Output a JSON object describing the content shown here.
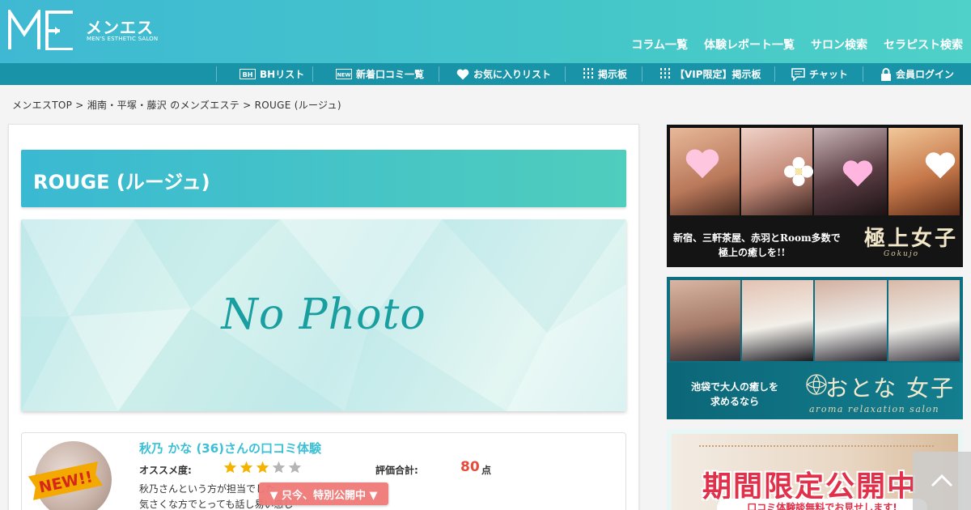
{
  "header": {
    "logo_kana": "メンエス",
    "logo_sub": "MEN'S ESTHETIC SALON",
    "nav": [
      "コラム一覧",
      "体験レポート一覧",
      "サロン検索",
      "セラピスト検索"
    ]
  },
  "subnav": [
    {
      "label": "BHリスト",
      "icon": "bh-icon"
    },
    {
      "label": "新着口コミ一覧",
      "icon": "new-icon"
    },
    {
      "label": "お気に入りリスト",
      "icon": "heart-icon"
    },
    {
      "label": "掲示板",
      "icon": "board-icon"
    },
    {
      "label": "【VIP限定】掲示板",
      "icon": "vip-board-icon"
    },
    {
      "label": "チャット",
      "icon": "chat-icon"
    },
    {
      "label": "会員ログイン",
      "icon": "lock-icon"
    }
  ],
  "breadcrumb": "メンエスTOP > 湘南・平塚・藤沢 のメンズエステ > ROUGE (ルージュ)",
  "salon": {
    "title": "ROUGE (ルージュ)",
    "no_photo": "No Photo"
  },
  "review": {
    "badge": "NEW!!",
    "title": "秋乃 かな (36)さんの口コミ体験",
    "recommend_label": "オススメ度:",
    "stars_filled": 3,
    "stars_total": 5,
    "total_label": "評価合計:",
    "score": "80",
    "score_unit": "点",
    "text_line1": "秋乃さんという方が担当でした",
    "text_line2": "気さくな方でとっても話し易い感じ",
    "special_button": "▼ 只今、特別公開中 ▼"
  },
  "banners": {
    "b1_copy_line1": "新宿、三軒茶屋、赤羽とRoom多数で",
    "b1_copy_line2": "極上の癒しを!!",
    "b1_brand": "極上女子",
    "b1_brand_sub": "Gokujo",
    "b2_copy_line1": "池袋で大人の癒しを",
    "b2_copy_line2": "求めるなら",
    "b2_brand": "おとな 女子",
    "b2_brand_sub": "aroma relaxation salon",
    "b3_title": "期間限定公開中",
    "b3_sub": "口コミ体験談無料でお見せします!"
  },
  "colors": {
    "header_start": "#3fb9d3",
    "header_end": "#4fd0c8",
    "subnav": "#1893a8",
    "accent": "#3cc0d5",
    "score": "#e34c3b",
    "star_on": "#f5b300",
    "star_off": "#b5b5b5",
    "special_button": "#ef7a78"
  }
}
